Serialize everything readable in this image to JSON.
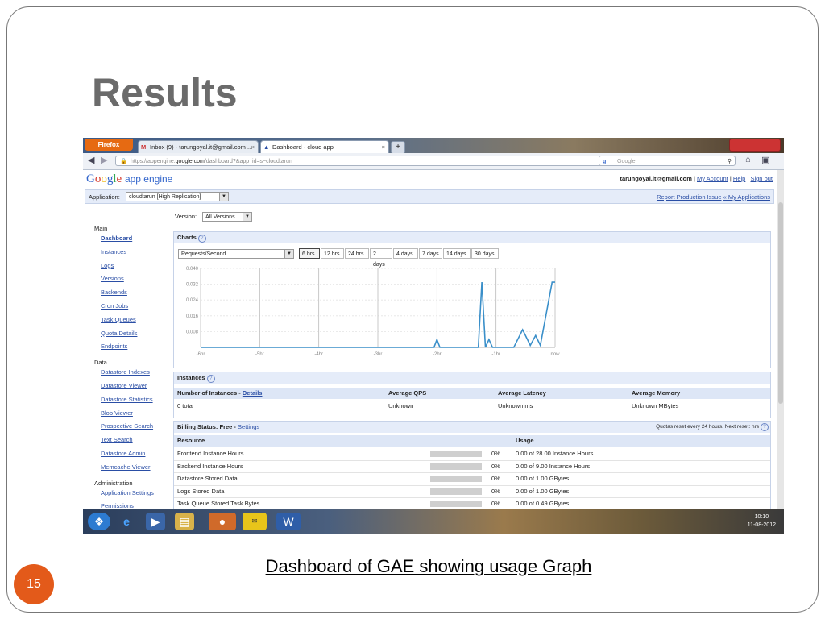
{
  "slide": {
    "title": "Results",
    "caption": "Dashboard of GAE showing usage Graph",
    "page_number": "15"
  },
  "browser": {
    "menu_button": "Firefox",
    "tabs": [
      {
        "label": "Inbox (9) - tarungoyal.it@gmail.com ...",
        "icon": "gmail-icon"
      },
      {
        "label": "Dashboard - cloud app",
        "icon": "appengine-icon"
      }
    ],
    "new_tab": "+",
    "url_prefix": "https://appengine.",
    "url_domain": "google.com",
    "url_rest": "/dashboard?&app_id=s~cloudtarun",
    "search_placeholder": "Google"
  },
  "header": {
    "logo_google": [
      "G",
      "o",
      "o",
      "g",
      "l",
      "e"
    ],
    "logo_product": "app engine",
    "user": "tarungoyal.it@gmail.com",
    "links": [
      "My Account",
      "Help",
      "Sign out"
    ],
    "application_label": "Application:",
    "application_value": "cloudtarun [High Replication]",
    "report_issue": "Report Production Issue",
    "my_apps": "« My Applications"
  },
  "sidebar": {
    "sections": [
      {
        "title": "Main",
        "items": [
          "Dashboard",
          "Instances",
          "Logs",
          "Versions",
          "Backends",
          "Cron Jobs",
          "Task Queues",
          "Quota Details",
          "Endpoints"
        ]
      },
      {
        "title": "Data",
        "items": [
          "Datastore Indexes",
          "Datastore Viewer",
          "Datastore Statistics",
          "Blob Viewer",
          "Prospective Search",
          "Text Search",
          "Datastore Admin",
          "Memcache Viewer"
        ]
      },
      {
        "title": "Administration",
        "items": [
          "Application Settings",
          "Permissions"
        ]
      }
    ]
  },
  "dashboard": {
    "version_label": "Version:",
    "version_value": "All Versions",
    "charts_title": "Charts",
    "chart_metric": "Requests/Second",
    "ranges": [
      "6 hrs",
      "12 hrs",
      "24 hrs",
      "2 days",
      "4 days",
      "7 days",
      "14 days",
      "30 days"
    ],
    "active_range": "6 hrs",
    "instances_title": "Instances",
    "instances_headers": [
      "Number of Instances - ",
      "Average QPS",
      "Average Latency",
      "Average Memory"
    ],
    "instances_details_link": "Details",
    "instances_row": [
      "0 total",
      "Unknown",
      "Unknown ms",
      "Unknown MBytes"
    ],
    "billing_label": "Billing Status: Free - ",
    "billing_link": "Settings",
    "quota_note": "Quotas reset every 24 hours. Next reset: hrs",
    "resource_header": "Resource",
    "usage_header": "Usage",
    "resources": [
      {
        "name": "Frontend Instance Hours",
        "pct": "0%",
        "usage": "0.00 of 28.00 Instance Hours",
        "fraction": 0
      },
      {
        "name": "Backend Instance Hours",
        "pct": "0%",
        "usage": "0.00 of 9.00 Instance Hours",
        "fraction": 0
      },
      {
        "name": "Datastore Stored Data",
        "pct": "0%",
        "usage": "0.00 of 1.00 GBytes",
        "fraction": 0
      },
      {
        "name": "Logs Stored Data",
        "pct": "0%",
        "usage": "0.00 of 1.00 GBytes",
        "fraction": 0
      },
      {
        "name": "Task Queue Stored Task Bytes",
        "pct": "0%",
        "usage": "0.00 of 0.49 GBytes",
        "fraction": 0
      }
    ]
  },
  "taskbar": {
    "time": "10:10",
    "date": "11-08-2012"
  },
  "chart_data": {
    "type": "line",
    "ylim": [
      0,
      0.04
    ],
    "yticks": [
      "0.040",
      "0.032",
      "0.024",
      "0.016",
      "0.008"
    ],
    "yvals": [
      0.04,
      0.032,
      0.024,
      0.016,
      0.008
    ],
    "xticks": [
      "-6hr",
      "-5hr",
      "-4hr",
      "-3hr",
      "-2hr",
      "-1hr",
      "now"
    ],
    "xlim": [
      -6,
      0
    ],
    "series": [
      {
        "color": "#3a8fc9",
        "points": [
          [
            -6,
            0
          ],
          [
            -2.05,
            0
          ],
          [
            -2.0,
            0.004
          ],
          [
            -1.95,
            0
          ],
          [
            -1.3,
            0
          ],
          [
            -1.24,
            0.033
          ],
          [
            -1.18,
            0
          ],
          [
            -1.12,
            0.004
          ],
          [
            -1.06,
            0
          ],
          [
            -0.7,
            0
          ],
          [
            -0.55,
            0.009
          ],
          [
            -0.42,
            0.001
          ],
          [
            -0.33,
            0.006
          ],
          [
            -0.25,
            0.001
          ],
          [
            -0.05,
            0.033
          ],
          [
            0,
            0.033
          ]
        ]
      }
    ]
  }
}
